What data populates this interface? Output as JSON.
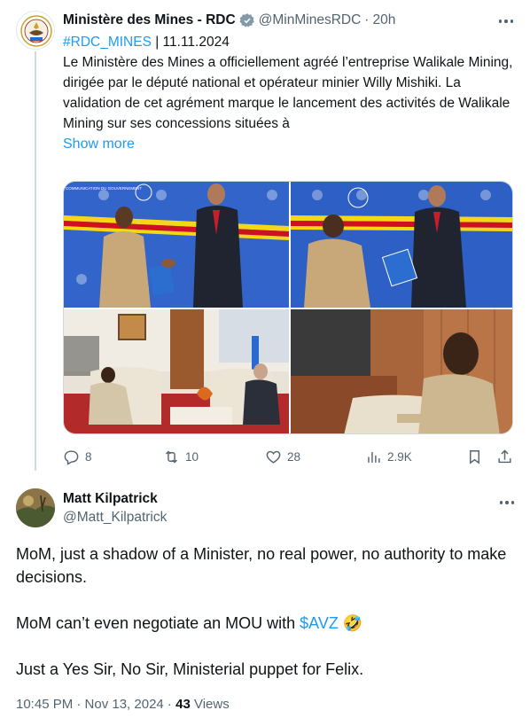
{
  "tweet": {
    "author_name": "Ministère des Mines - RDC",
    "author_handle": "@MinMinesRDC",
    "time": "20h",
    "hashtag": "#RDC_MINES",
    "date_text": " | 11.11.2024",
    "body": "Le Ministère des Mines a officiellement agréé l’entreprise Walikale Mining, dirigée par le député national et opérateur minier Willy Mishiki. La validation de cet agrément marque le lancement des activités de Walikale Mining sur ses concessions situées à",
    "show_more": "Show more",
    "media_banner_text": "COMMUNICATION DU GOUVERNEMENT",
    "stats": {
      "replies": "8",
      "retweets": "10",
      "likes": "28",
      "views": "2.9K"
    }
  },
  "reply": {
    "author_name": "Matt Kilpatrick",
    "author_handle": "@Matt_Kilpatrick",
    "paragraph1": "MoM, just a shadow of a Minister, no real power, no authority to make decisions.",
    "paragraph2_before": "MoM can’t even negotiate an MOU with ",
    "cashtag": "$AVZ",
    "paragraph2_emoji": "🤣",
    "paragraph3": "Just a Yes Sir, No Sir, Ministerial puppet for Felix.",
    "timestamp": "10:45 PM · Nov 13, 2024 · ",
    "views_count": "43",
    "views_label": " Views"
  },
  "colors": {
    "accent": "#1d9bf0",
    "secondary_text": "#536471",
    "verified_badge": "#829aab"
  }
}
